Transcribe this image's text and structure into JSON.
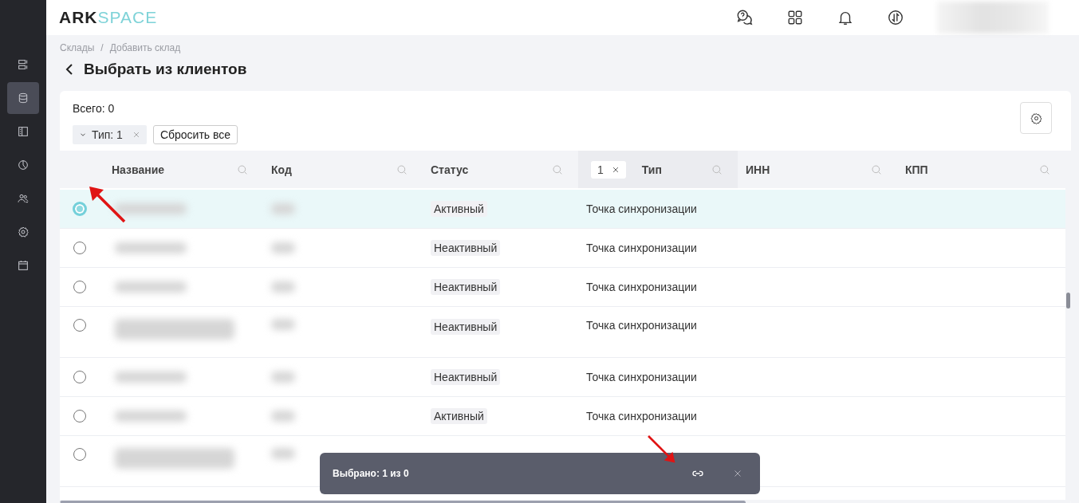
{
  "logo": {
    "dark": "ARK",
    "light": "SPACE"
  },
  "sidebar": {
    "items": [
      {
        "selected": false
      },
      {
        "selected": true
      },
      {
        "selected": false
      },
      {
        "selected": false
      },
      {
        "selected": false
      },
      {
        "selected": false
      },
      {
        "selected": false
      }
    ]
  },
  "breadcrumbs": [
    "Склады",
    "Добавить склад"
  ],
  "breadcrumb_separator": "/",
  "title": "Выбрать из клиентов",
  "total": "Всего: 0",
  "filters": [
    {
      "label": "Тип: 1"
    }
  ],
  "reset_button": "Сбросить все",
  "table": {
    "columns": [
      {
        "label": "Название"
      },
      {
        "label": "Код"
      },
      {
        "label": "Статус"
      },
      {
        "label": "Тип",
        "filter_value": "1"
      },
      {
        "label": "ИНН"
      },
      {
        "label": "КПП"
      }
    ],
    "rows": [
      {
        "selected": true,
        "tall": false,
        "status": "Активный",
        "type": "Точка синхронизации"
      },
      {
        "selected": false,
        "tall": false,
        "status": "Неактивный",
        "type": "Точка синхронизации"
      },
      {
        "selected": false,
        "tall": false,
        "status": "Неактивный",
        "type": "Точка синхронизации"
      },
      {
        "selected": false,
        "tall": true,
        "status": "Неактивный",
        "type": "Точка синхронизации"
      },
      {
        "selected": false,
        "tall": false,
        "status": "Неактивный",
        "type": "Точка синхронизации"
      },
      {
        "selected": false,
        "tall": false,
        "status": "Активный",
        "type": "Точка синхронизации"
      },
      {
        "selected": false,
        "tall": true
      }
    ]
  },
  "toast": {
    "text": "Выбрано: 1 из 0"
  },
  "annotations": [
    {
      "kind": "arrow"
    },
    {
      "kind": "arrow"
    }
  ]
}
